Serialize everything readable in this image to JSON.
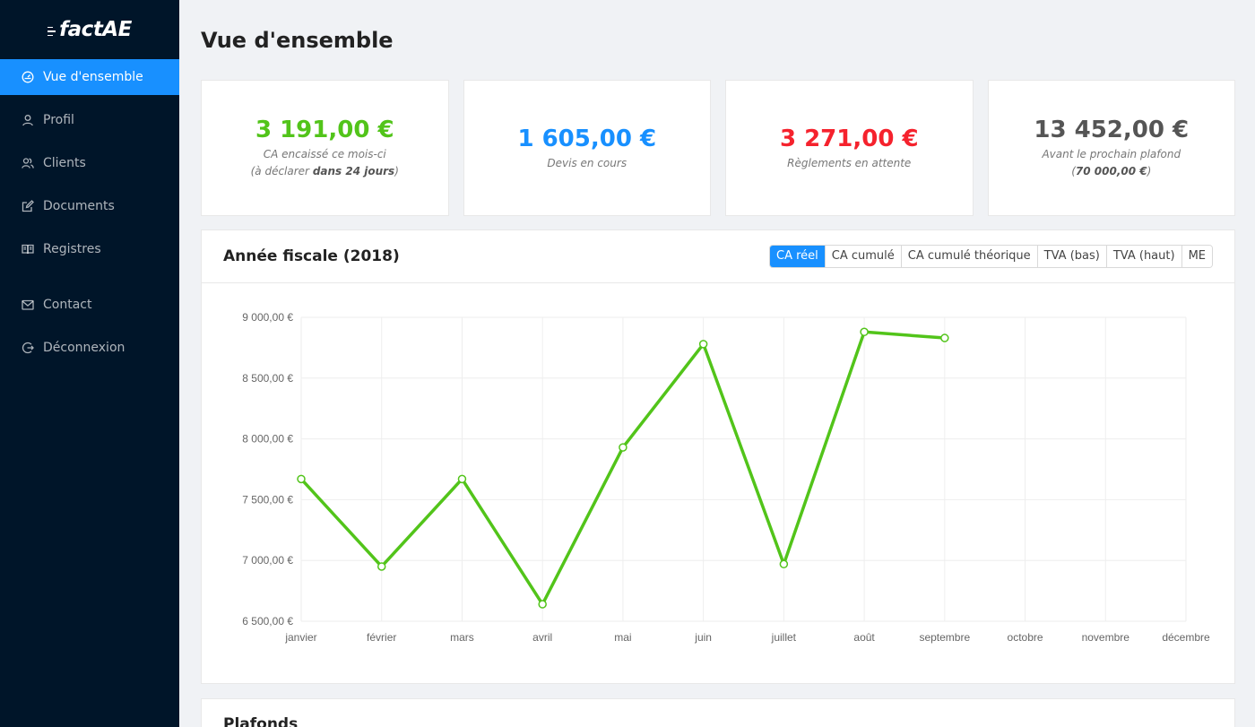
{
  "app": {
    "logo": "factAE"
  },
  "sidebar": {
    "items": [
      {
        "label": "Vue d'ensemble",
        "icon": "dashboard-icon",
        "active": true
      },
      {
        "label": "Profil",
        "icon": "user-icon"
      },
      {
        "label": "Clients",
        "icon": "team-icon"
      },
      {
        "label": "Documents",
        "icon": "edit-icon"
      },
      {
        "label": "Registres",
        "icon": "book-icon"
      },
      {
        "label": "Contact",
        "icon": "mail-icon"
      },
      {
        "label": "Déconnexion",
        "icon": "logout-icon"
      }
    ]
  },
  "page": {
    "title": "Vue d'ensemble"
  },
  "stats": [
    {
      "value": "3 191,00 €",
      "line1": "CA encaissé ce mois-ci",
      "line2_pre": "(à déclarer ",
      "line2_bold": "dans 24 jours",
      "line2_post": ")",
      "color": "#52c41a"
    },
    {
      "value": "1 605,00 €",
      "line1": "Devis en cours",
      "color": "#1890ff"
    },
    {
      "value": "3 271,00 €",
      "line1": "Règlements en attente",
      "color": "#f5222d"
    },
    {
      "value": "13 452,00 €",
      "line1": "Avant le prochain plafond",
      "line2_pre": "(",
      "line2_bold": "70 000,00 €",
      "line2_post": ")",
      "color": "#555555"
    }
  ],
  "chart_card": {
    "title": "Année fiscale (2018)",
    "tabs": [
      {
        "label": "CA réel",
        "active": true
      },
      {
        "label": "CA cumulé"
      },
      {
        "label": "CA cumulé théorique"
      },
      {
        "label": "TVA (bas)"
      },
      {
        "label": "TVA (haut)"
      },
      {
        "label": "ME"
      }
    ]
  },
  "chart_data": {
    "type": "line",
    "categories": [
      "janvier",
      "février",
      "mars",
      "avril",
      "mai",
      "juin",
      "juillet",
      "août",
      "septembre",
      "octobre",
      "novembre",
      "décembre"
    ],
    "series": [
      {
        "values": [
          7670,
          6950,
          7670,
          6640,
          7930,
          8780,
          6970,
          8880,
          8830,
          null,
          null,
          null
        ],
        "color": "#52c41a"
      }
    ],
    "ylim": [
      6500,
      9000
    ],
    "yticks": [
      9000,
      8500,
      8000,
      7500,
      7000,
      6500
    ],
    "ytick_labels": [
      "9 000,00 €",
      "8 500,00 €",
      "8 000,00 €",
      "7 500,00 €",
      "7 000,00 €",
      "6 500,00 €"
    ],
    "grid": true
  },
  "plafonds": {
    "title": "Plafonds"
  }
}
